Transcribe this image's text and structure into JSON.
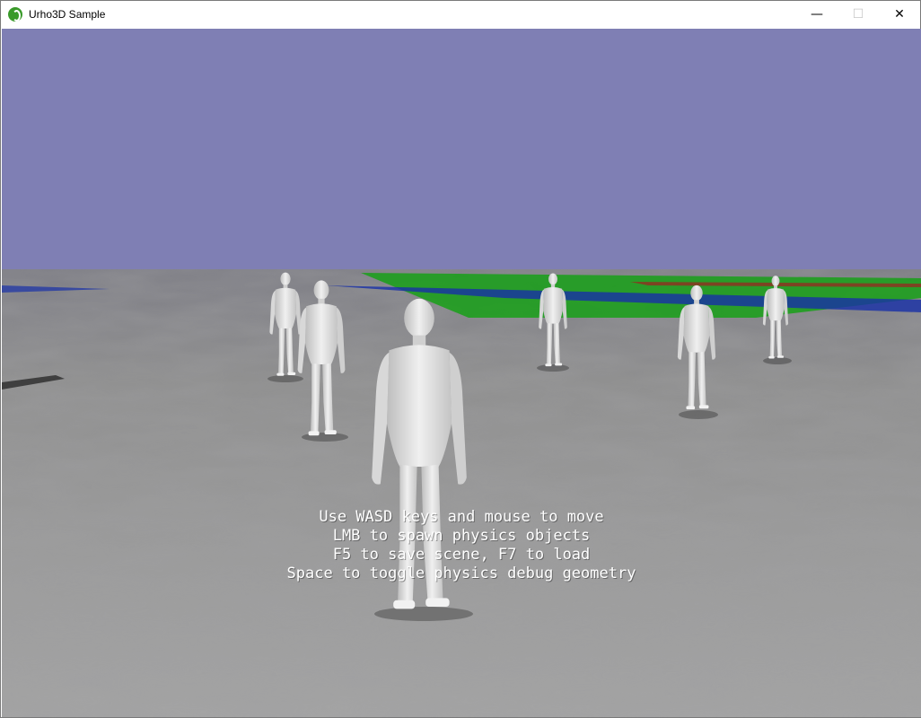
{
  "window": {
    "title": "Urho3D Sample",
    "icon": "urho3d-leaf-icon",
    "controls": {
      "minimize": "—",
      "maximize": "☐",
      "close": "✕"
    }
  },
  "scene": {
    "sky_color": "#7f7fb4",
    "ground_color": "#8a8a8a",
    "debug_colors": [
      "#18a018",
      "#1830a8",
      "#a02020"
    ],
    "character_color": "#e6e6e6"
  },
  "instructions": [
    "Use WASD keys and mouse to move",
    "LMB to spawn physics objects",
    "F5 to save scene, F7 to load",
    "Space to toggle physics debug geometry"
  ]
}
